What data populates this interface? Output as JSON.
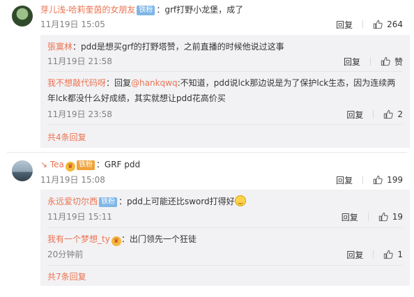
{
  "comments": [
    {
      "user": "芽儿浅-哈莉奎茵的女朋友",
      "badge": "铁粉",
      "text": "：grf打野小龙堡，成了",
      "time": "11月19日 15:05",
      "reply_label": "回复",
      "likes": "264",
      "replies": [
        {
          "user": "張寞林",
          "text": "：pdd是想买grf的打野塔赞，之前直播的时候他说过这事",
          "time": "11月19日 21:58",
          "reply_label": "回复",
          "likes": "赞"
        },
        {
          "user": "我不想敲代码呀",
          "text_prefix": "：回复",
          "mention": "@hankqwq",
          "text": ":不知道，pdd说lck那边说是为了保护lck生态，因为连续两",
          "text2": "年lck都没什么好成绩，其实就想让pdd花高价买",
          "time": "11月19日 23:58",
          "reply_label": "回复",
          "likes": "2"
        }
      ],
      "more_replies": "共4条回复"
    },
    {
      "user": "Tea",
      "badge": "铁粉",
      "text": "：GRF pdd",
      "time": "11月19日 15:08",
      "reply_label": "回复",
      "likes": "199",
      "replies": [
        {
          "user": "永远爱切尔西",
          "badge": "铁粉",
          "text": "：pdd上可能还比sword打得好",
          "time": "11月19日 15:11",
          "reply_label": "回复",
          "likes": "19"
        },
        {
          "user": "我有一个梦想_ty",
          "text": "：出门领先一个狂徒",
          "time": "20分钟前",
          "reply_label": "回复",
          "likes": "1"
        }
      ],
      "more_replies": "共7条回复"
    }
  ],
  "colors": {
    "link": "#eb7350",
    "badge": "#7fb6e6",
    "reply_bg": "#f2f2f5",
    "meta": "#808080"
  },
  "icons": {
    "like": "thumbs-up-icon",
    "vip": "vip-crown-icon"
  }
}
